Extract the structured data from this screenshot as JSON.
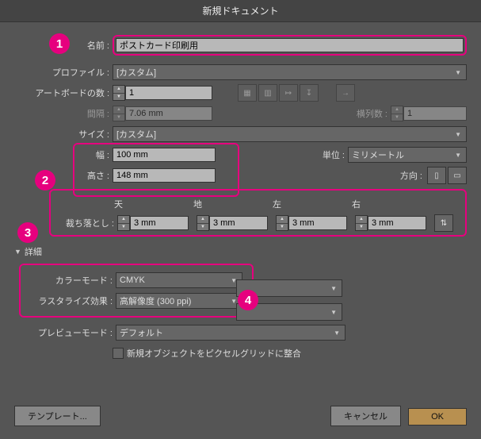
{
  "title": "新規ドキュメント",
  "labels": {
    "name": "名前 :",
    "profile": "プロファイル :",
    "artboards": "アートボードの数 :",
    "spacing": "間隔 :",
    "columns": "横列数 :",
    "size": "サイズ :",
    "width": "幅 :",
    "height": "高さ :",
    "units": "単位 :",
    "orientation": "方向 :",
    "bleed": "裁ち落とし :",
    "top": "天",
    "bottom": "地",
    "left": "左",
    "right": "右",
    "advanced": "詳細",
    "colorMode": "カラーモード :",
    "raster": "ラスタライズ効果 :",
    "preview": "プレビューモード :",
    "align": "新規オブジェクトをピクセルグリッドに整合"
  },
  "values": {
    "name": "ポストカード印刷用",
    "profile": "[カスタム]",
    "artboards": "1",
    "spacing": "7.06 mm",
    "columns": "1",
    "size": "[カスタム]",
    "width": "100 mm",
    "height": "148 mm",
    "units": "ミリメートル",
    "bleedTop": "3 mm",
    "bleedBottom": "3 mm",
    "bleedLeft": "3 mm",
    "bleedRight": "3 mm",
    "colorMode": "CMYK",
    "raster": "高解像度 (300 ppi)",
    "preview": "デフォルト"
  },
  "buttons": {
    "template": "テンプレート...",
    "cancel": "キャンセル",
    "ok": "OK"
  },
  "badges": {
    "b1": "1",
    "b2": "2",
    "b3": "3",
    "b4": "4"
  }
}
